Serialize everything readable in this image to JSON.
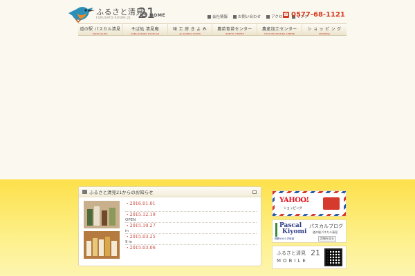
{
  "header": {
    "logo_text": "ふるさと清見",
    "logo_sub": "FURUSATO-KIYOMI 21",
    "logo_num": "21",
    "home_label": "HOME",
    "util_links": [
      "会社情報",
      "お問い合わせ",
      "アクセス",
      "リンク"
    ],
    "phone": "0577-68-1121"
  },
  "gnav": [
    {
      "label": "道の駅 パスカル清見",
      "sub": "MICHI-NO-EKI"
    },
    {
      "label": "そば処 清見庵",
      "sub": "SOBA-DOKORO KIYOMI-AN"
    },
    {
      "label": "味 工 房 き よ み",
      "sub": "AJI-KOUBOU KIYOMI"
    },
    {
      "label": "農苗育苗センター",
      "sub": "IKUBYOU CENTER"
    },
    {
      "label": "農産加工センター",
      "sub": "FOOD PROCESSING CENTER"
    },
    {
      "label": "シ ョ ッ ピ ン グ",
      "sub": "SHOPPING"
    }
  ],
  "news": {
    "title": "ふるさと清見21からのお知らせ",
    "items": [
      {
        "date": "・2016.01.01",
        "text": ""
      },
      {
        "date": "・2015.12.19",
        "text": "OPEN"
      },
      {
        "date": "・2015.10.27",
        "text": "in"
      },
      {
        "date": "・2015.03.25",
        "text": "9 in"
      },
      {
        "date": "・2015.03.06",
        "text": ""
      }
    ]
  },
  "banners": {
    "yahoo": {
      "logo": "YAHOO!",
      "logo_sub": "JAPAN",
      "sub": "ショッピング"
    },
    "pascal": {
      "logo1": "Pascal",
      "logo2": "Kiyomi",
      "sub": "飛騨せせらぎ街道",
      "blog": "パスカルブログ",
      "blog_sub": "道の駅パスカル清見",
      "button": "詳細を見る"
    },
    "mobile": {
      "line1": "ふるさと清見",
      "num": "21",
      "line2": "MOBILE"
    }
  }
}
